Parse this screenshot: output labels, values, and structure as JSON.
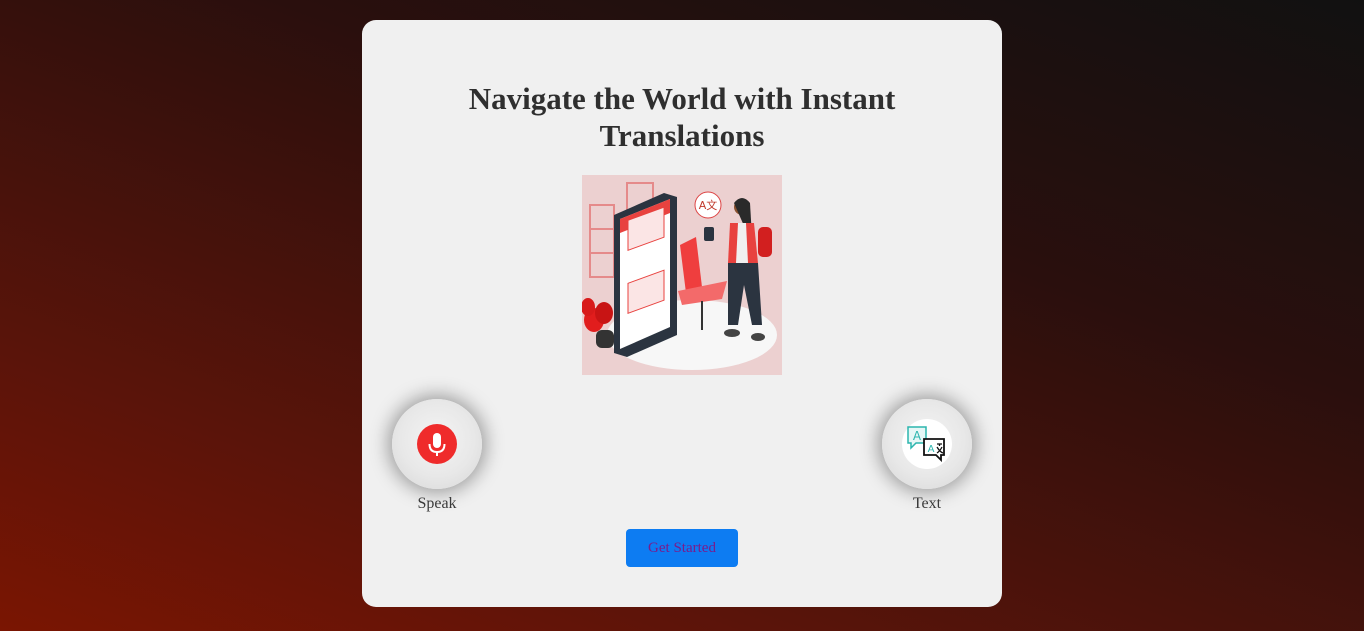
{
  "hero": {
    "title": "Navigate the World with Instant Translations"
  },
  "illustration": {
    "icon": "translation-app-illustration",
    "bubble_glyph": "A文"
  },
  "actions": {
    "speak": {
      "label": "Speak",
      "icon": "microphone-icon"
    },
    "text": {
      "label": "Text",
      "icon": "translate-chat-icon"
    }
  },
  "cta": {
    "label": "Get Started"
  },
  "colors": {
    "card_background": "#f0f0f0",
    "title": "#2f2f2f",
    "mic_red": "#ef2b2b",
    "cta_blue": "#0d7cf2",
    "cta_text": "#7a1c8c",
    "illustration_bg": "#ecd0d0"
  }
}
